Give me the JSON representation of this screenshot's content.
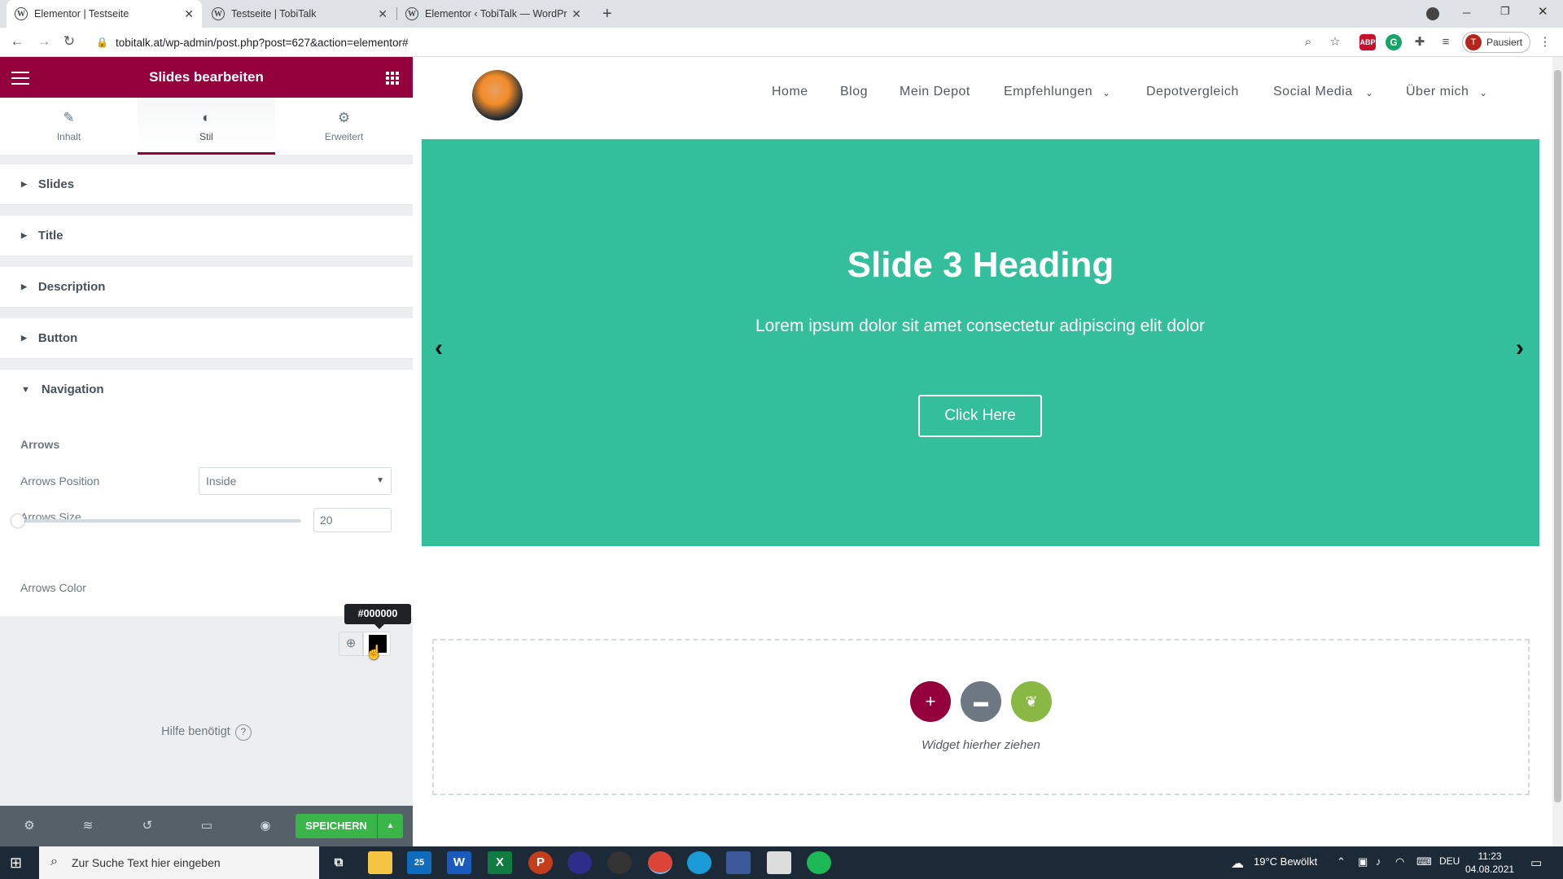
{
  "browser": {
    "tabs": [
      {
        "title": "Elementor | Testseite",
        "active": true
      },
      {
        "title": "Testseite | TobiTalk",
        "active": false
      },
      {
        "title": "Elementor ‹ TobiTalk — WordPre",
        "active": false
      }
    ],
    "new_tab_icon": "plus-icon",
    "url": "tobitalk.at/wp-admin/post.php?post=627&action=elementor#",
    "profile_initial": "T",
    "profile_label": "Pausiert"
  },
  "panel": {
    "header_title": "Slides bearbeiten",
    "tabs": [
      {
        "label": "Inhalt",
        "icon": "pencil-icon"
      },
      {
        "label": "Stil",
        "icon": "half-circle-icon",
        "active": true
      },
      {
        "label": "Erweitert",
        "icon": "gear-icon"
      }
    ],
    "sections": [
      "Slides",
      "Title",
      "Description",
      "Button",
      "Navigation"
    ],
    "navigation": {
      "subheading": "Arrows",
      "position_label": "Arrows Position",
      "position_value": "Inside",
      "size_label": "Arrows Size",
      "size_value": "20",
      "size_fraction": 0.0,
      "color_label": "Arrows Color",
      "color_value": "#000000",
      "tooltip": "#000000"
    },
    "help": "Hilfe benötigt",
    "help_icon": "?",
    "save_label": "SPEICHERN"
  },
  "site": {
    "menu": [
      "Home",
      "Blog",
      "Mein Depot",
      "Empfehlungen",
      "Depotvergleich",
      "Social Media",
      "Über mich"
    ],
    "slide": {
      "heading": "Slide 3 Heading",
      "description": "Lorem ipsum dolor sit amet consectetur adipiscing elit dolor",
      "button": "Click Here",
      "bg_color": "#33bf9b"
    },
    "dropzone_text": "Widget hierher ziehen"
  },
  "taskbar": {
    "search_placeholder": "Zur Suche Text hier eingeben",
    "mail_badge": "25",
    "weather": "19°C  Bewölkt",
    "language": "DEU",
    "time": "11:23",
    "date": "04.08.2021"
  },
  "colors": {
    "elementor_brand": "#93003c",
    "save_green": "#39b54a",
    "slide_bg": "#33bf9b"
  }
}
